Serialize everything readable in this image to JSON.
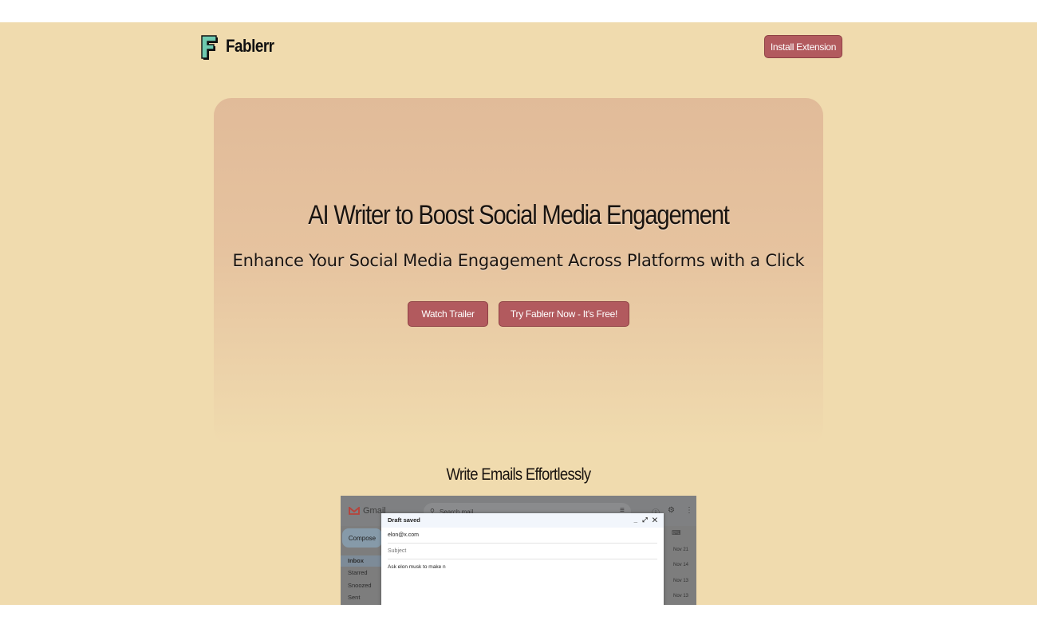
{
  "brand": {
    "name": "Fablerr"
  },
  "header": {
    "install_label": "Install Extension"
  },
  "hero": {
    "title": "AI Writer to Boost Social Media Engagement",
    "subtitle": "Enhance Your Social Media Engagement Across Platforms with a Click",
    "watch_label": "Watch Trailer",
    "try_label": "Try Fablerr Now - It's Free!"
  },
  "section": {
    "title": "Write Emails Effortlessly"
  },
  "screenshot": {
    "app_name": "Gmail",
    "search_placeholder": "Search mail",
    "compose_label": "Compose",
    "nav": [
      "Inbox",
      "Starred",
      "Snoozed",
      "Sent"
    ],
    "dates": [
      "Nov 21",
      "Nov 14",
      "Nov 13",
      "Nov 13"
    ],
    "draft": {
      "status": "Draft saved",
      "to": "elon@x.com",
      "subject_placeholder": "Subject",
      "body": "Ask elon musk to make n"
    }
  },
  "colors": {
    "page_bg": "#f0dbae",
    "button": "#b25a5e",
    "logo_teal": "#6fcab0"
  }
}
